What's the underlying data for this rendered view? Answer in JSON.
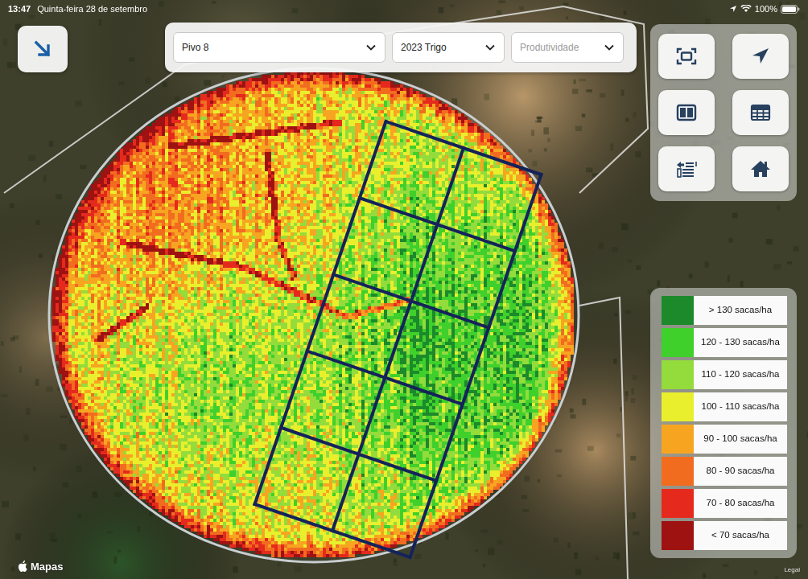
{
  "status_bar": {
    "time": "13:47",
    "date": "Quinta-feira 28 de setembro",
    "battery": "100%",
    "battery_level": 1
  },
  "filters": [
    {
      "label": "Pivo 8",
      "placeholder": false
    },
    {
      "label": "2023 Trigo",
      "placeholder": false
    },
    {
      "label": "Produtividade",
      "placeholder": true
    }
  ],
  "legend": [
    {
      "label": "> 130 sacas/ha",
      "color": "#1c8a2a"
    },
    {
      "label": "120 - 130 sacas/ha",
      "color": "#3fd02c"
    },
    {
      "label": "110 - 120 sacas/ha",
      "color": "#93dc3c"
    },
    {
      "label": "100 - 110 sacas/ha",
      "color": "#e9ef2c"
    },
    {
      "label": "90 - 100 sacas/ha",
      "color": "#f7a521"
    },
    {
      "label": "80 - 90 sacas/ha",
      "color": "#f26c1f"
    },
    {
      "label": "70 - 80 sacas/ha",
      "color": "#e52a1d"
    },
    {
      "label": "< 70 sacas/ha",
      "color": "#9e1212"
    }
  ],
  "map": {
    "attribution": "Mapas",
    "legal": "Legal"
  }
}
